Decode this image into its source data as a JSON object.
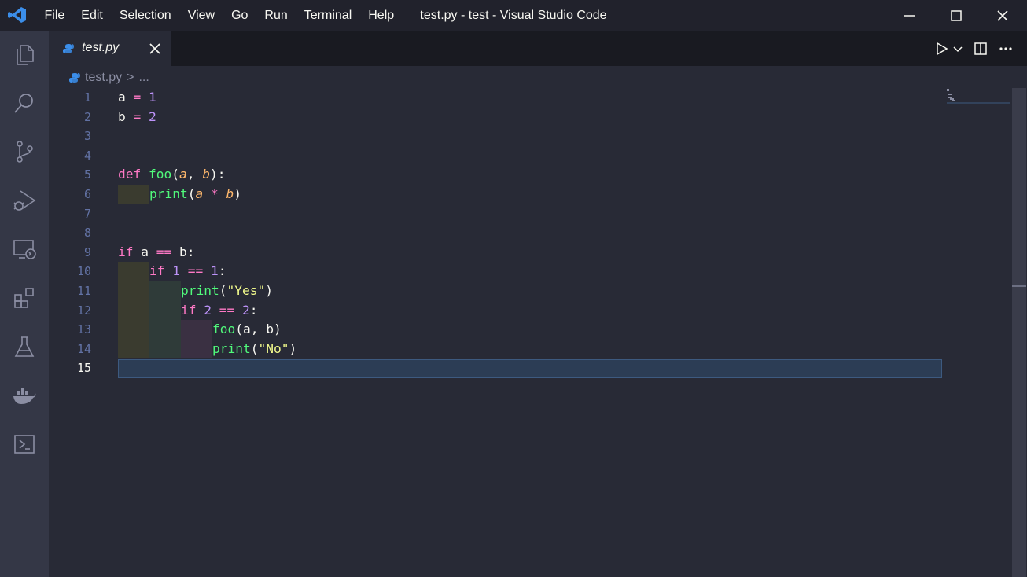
{
  "window": {
    "title": "test.py - test - Visual Studio Code"
  },
  "menu": [
    "File",
    "Edit",
    "Selection",
    "View",
    "Go",
    "Run",
    "Terminal",
    "Help"
  ],
  "activity_icons": [
    "explorer-icon",
    "search-icon",
    "source-control-icon",
    "run-debug-icon",
    "remote-explorer-icon",
    "extensions-icon",
    "testing-icon",
    "docker-icon",
    "powershell-icon"
  ],
  "tab": {
    "label": "test.py",
    "icon": "python-icon",
    "close_icon": "close-icon"
  },
  "breadcrumb": {
    "file": "test.py",
    "separator": ">",
    "ellipsis": "..."
  },
  "editor": {
    "active_line": 15,
    "lines": [
      {
        "n": "1",
        "tokens": [
          {
            "t": "a ",
            "c": ""
          },
          {
            "t": "=",
            "c": "op"
          },
          {
            "t": " ",
            "c": ""
          },
          {
            "t": "1",
            "c": "num"
          }
        ]
      },
      {
        "n": "2",
        "tokens": [
          {
            "t": "b ",
            "c": ""
          },
          {
            "t": "=",
            "c": "op"
          },
          {
            "t": " ",
            "c": ""
          },
          {
            "t": "2",
            "c": "num"
          }
        ]
      },
      {
        "n": "3",
        "tokens": []
      },
      {
        "n": "4",
        "tokens": []
      },
      {
        "n": "5",
        "tokens": [
          {
            "t": "def",
            "c": "kw"
          },
          {
            "t": " ",
            "c": ""
          },
          {
            "t": "foo",
            "c": "fn"
          },
          {
            "t": "(",
            "c": ""
          },
          {
            "t": "a",
            "c": "param"
          },
          {
            "t": ", ",
            "c": ""
          },
          {
            "t": "b",
            "c": "param"
          },
          {
            "t": "):",
            "c": ""
          }
        ]
      },
      {
        "n": "6",
        "indent": 1,
        "tokens": [
          {
            "t": "print",
            "c": "fn"
          },
          {
            "t": "(",
            "c": ""
          },
          {
            "t": "a",
            "c": "param"
          },
          {
            "t": " ",
            "c": ""
          },
          {
            "t": "*",
            "c": "op"
          },
          {
            "t": " ",
            "c": ""
          },
          {
            "t": "b",
            "c": "param"
          },
          {
            "t": ")",
            "c": ""
          }
        ]
      },
      {
        "n": "7",
        "tokens": []
      },
      {
        "n": "8",
        "tokens": []
      },
      {
        "n": "9",
        "tokens": [
          {
            "t": "if",
            "c": "kw"
          },
          {
            "t": " a ",
            "c": ""
          },
          {
            "t": "==",
            "c": "op"
          },
          {
            "t": " b:",
            "c": ""
          }
        ]
      },
      {
        "n": "10",
        "indent": 1,
        "tokens": [
          {
            "t": "if",
            "c": "kw"
          },
          {
            "t": " ",
            "c": ""
          },
          {
            "t": "1",
            "c": "num"
          },
          {
            "t": " ",
            "c": ""
          },
          {
            "t": "==",
            "c": "op"
          },
          {
            "t": " ",
            "c": ""
          },
          {
            "t": "1",
            "c": "num"
          },
          {
            "t": ":",
            "c": ""
          }
        ]
      },
      {
        "n": "11",
        "indent": 2,
        "tokens": [
          {
            "t": "print",
            "c": "fn"
          },
          {
            "t": "(",
            "c": ""
          },
          {
            "t": "\"Yes\"",
            "c": "str"
          },
          {
            "t": ")",
            "c": ""
          }
        ]
      },
      {
        "n": "12",
        "indent": 2,
        "tokens": [
          {
            "t": "if",
            "c": "kw"
          },
          {
            "t": " ",
            "c": ""
          },
          {
            "t": "2",
            "c": "num"
          },
          {
            "t": " ",
            "c": ""
          },
          {
            "t": "==",
            "c": "op"
          },
          {
            "t": " ",
            "c": ""
          },
          {
            "t": "2",
            "c": "num"
          },
          {
            "t": ":",
            "c": ""
          }
        ]
      },
      {
        "n": "13",
        "indent": 3,
        "tokens": [
          {
            "t": "foo",
            "c": "fn"
          },
          {
            "t": "(a, b)",
            "c": ""
          }
        ]
      },
      {
        "n": "14",
        "indent": 3,
        "tokens": [
          {
            "t": "print",
            "c": "fn"
          },
          {
            "t": "(",
            "c": ""
          },
          {
            "t": "\"No\"",
            "c": "str"
          },
          {
            "t": ")",
            "c": ""
          }
        ]
      },
      {
        "n": "15",
        "tokens": []
      }
    ]
  },
  "colors": {
    "background": "#282a36",
    "titlebar": "#21222c",
    "activitybar": "#343746",
    "tab_accent": "#ff79c6",
    "keyword": "#ff79c6",
    "function": "#50fa7b",
    "number": "#bd93f9",
    "string": "#f1fa8c",
    "parameter": "#ffb86c"
  }
}
